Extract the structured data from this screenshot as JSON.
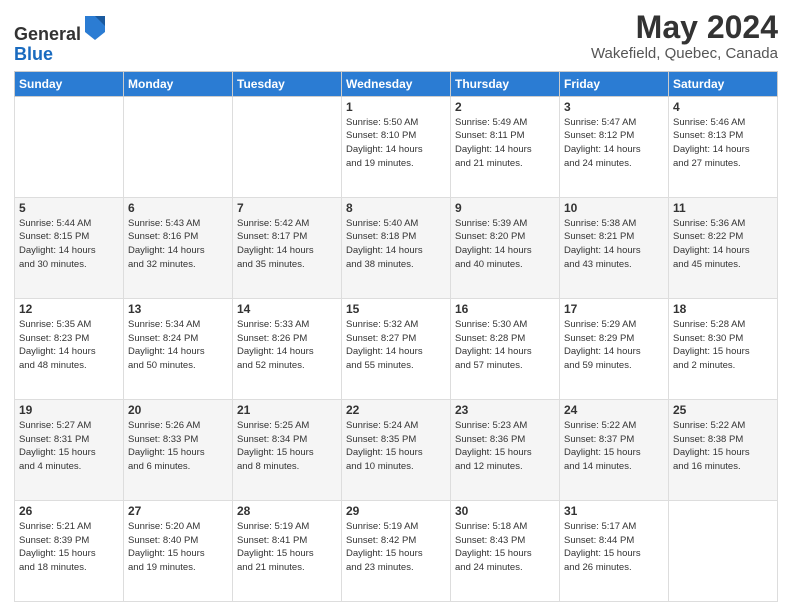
{
  "header": {
    "logo_general": "General",
    "logo_blue": "Blue",
    "month_title": "May 2024",
    "location": "Wakefield, Quebec, Canada"
  },
  "days_of_week": [
    "Sunday",
    "Monday",
    "Tuesday",
    "Wednesday",
    "Thursday",
    "Friday",
    "Saturday"
  ],
  "weeks": [
    [
      {
        "day": "",
        "info": ""
      },
      {
        "day": "",
        "info": ""
      },
      {
        "day": "",
        "info": ""
      },
      {
        "day": "1",
        "info": "Sunrise: 5:50 AM\nSunset: 8:10 PM\nDaylight: 14 hours\nand 19 minutes."
      },
      {
        "day": "2",
        "info": "Sunrise: 5:49 AM\nSunset: 8:11 PM\nDaylight: 14 hours\nand 21 minutes."
      },
      {
        "day": "3",
        "info": "Sunrise: 5:47 AM\nSunset: 8:12 PM\nDaylight: 14 hours\nand 24 minutes."
      },
      {
        "day": "4",
        "info": "Sunrise: 5:46 AM\nSunset: 8:13 PM\nDaylight: 14 hours\nand 27 minutes."
      }
    ],
    [
      {
        "day": "5",
        "info": "Sunrise: 5:44 AM\nSunset: 8:15 PM\nDaylight: 14 hours\nand 30 minutes."
      },
      {
        "day": "6",
        "info": "Sunrise: 5:43 AM\nSunset: 8:16 PM\nDaylight: 14 hours\nand 32 minutes."
      },
      {
        "day": "7",
        "info": "Sunrise: 5:42 AM\nSunset: 8:17 PM\nDaylight: 14 hours\nand 35 minutes."
      },
      {
        "day": "8",
        "info": "Sunrise: 5:40 AM\nSunset: 8:18 PM\nDaylight: 14 hours\nand 38 minutes."
      },
      {
        "day": "9",
        "info": "Sunrise: 5:39 AM\nSunset: 8:20 PM\nDaylight: 14 hours\nand 40 minutes."
      },
      {
        "day": "10",
        "info": "Sunrise: 5:38 AM\nSunset: 8:21 PM\nDaylight: 14 hours\nand 43 minutes."
      },
      {
        "day": "11",
        "info": "Sunrise: 5:36 AM\nSunset: 8:22 PM\nDaylight: 14 hours\nand 45 minutes."
      }
    ],
    [
      {
        "day": "12",
        "info": "Sunrise: 5:35 AM\nSunset: 8:23 PM\nDaylight: 14 hours\nand 48 minutes."
      },
      {
        "day": "13",
        "info": "Sunrise: 5:34 AM\nSunset: 8:24 PM\nDaylight: 14 hours\nand 50 minutes."
      },
      {
        "day": "14",
        "info": "Sunrise: 5:33 AM\nSunset: 8:26 PM\nDaylight: 14 hours\nand 52 minutes."
      },
      {
        "day": "15",
        "info": "Sunrise: 5:32 AM\nSunset: 8:27 PM\nDaylight: 14 hours\nand 55 minutes."
      },
      {
        "day": "16",
        "info": "Sunrise: 5:30 AM\nSunset: 8:28 PM\nDaylight: 14 hours\nand 57 minutes."
      },
      {
        "day": "17",
        "info": "Sunrise: 5:29 AM\nSunset: 8:29 PM\nDaylight: 14 hours\nand 59 minutes."
      },
      {
        "day": "18",
        "info": "Sunrise: 5:28 AM\nSunset: 8:30 PM\nDaylight: 15 hours\nand 2 minutes."
      }
    ],
    [
      {
        "day": "19",
        "info": "Sunrise: 5:27 AM\nSunset: 8:31 PM\nDaylight: 15 hours\nand 4 minutes."
      },
      {
        "day": "20",
        "info": "Sunrise: 5:26 AM\nSunset: 8:33 PM\nDaylight: 15 hours\nand 6 minutes."
      },
      {
        "day": "21",
        "info": "Sunrise: 5:25 AM\nSunset: 8:34 PM\nDaylight: 15 hours\nand 8 minutes."
      },
      {
        "day": "22",
        "info": "Sunrise: 5:24 AM\nSunset: 8:35 PM\nDaylight: 15 hours\nand 10 minutes."
      },
      {
        "day": "23",
        "info": "Sunrise: 5:23 AM\nSunset: 8:36 PM\nDaylight: 15 hours\nand 12 minutes."
      },
      {
        "day": "24",
        "info": "Sunrise: 5:22 AM\nSunset: 8:37 PM\nDaylight: 15 hours\nand 14 minutes."
      },
      {
        "day": "25",
        "info": "Sunrise: 5:22 AM\nSunset: 8:38 PM\nDaylight: 15 hours\nand 16 minutes."
      }
    ],
    [
      {
        "day": "26",
        "info": "Sunrise: 5:21 AM\nSunset: 8:39 PM\nDaylight: 15 hours\nand 18 minutes."
      },
      {
        "day": "27",
        "info": "Sunrise: 5:20 AM\nSunset: 8:40 PM\nDaylight: 15 hours\nand 19 minutes."
      },
      {
        "day": "28",
        "info": "Sunrise: 5:19 AM\nSunset: 8:41 PM\nDaylight: 15 hours\nand 21 minutes."
      },
      {
        "day": "29",
        "info": "Sunrise: 5:19 AM\nSunset: 8:42 PM\nDaylight: 15 hours\nand 23 minutes."
      },
      {
        "day": "30",
        "info": "Sunrise: 5:18 AM\nSunset: 8:43 PM\nDaylight: 15 hours\nand 24 minutes."
      },
      {
        "day": "31",
        "info": "Sunrise: 5:17 AM\nSunset: 8:44 PM\nDaylight: 15 hours\nand 26 minutes."
      },
      {
        "day": "",
        "info": ""
      }
    ]
  ]
}
